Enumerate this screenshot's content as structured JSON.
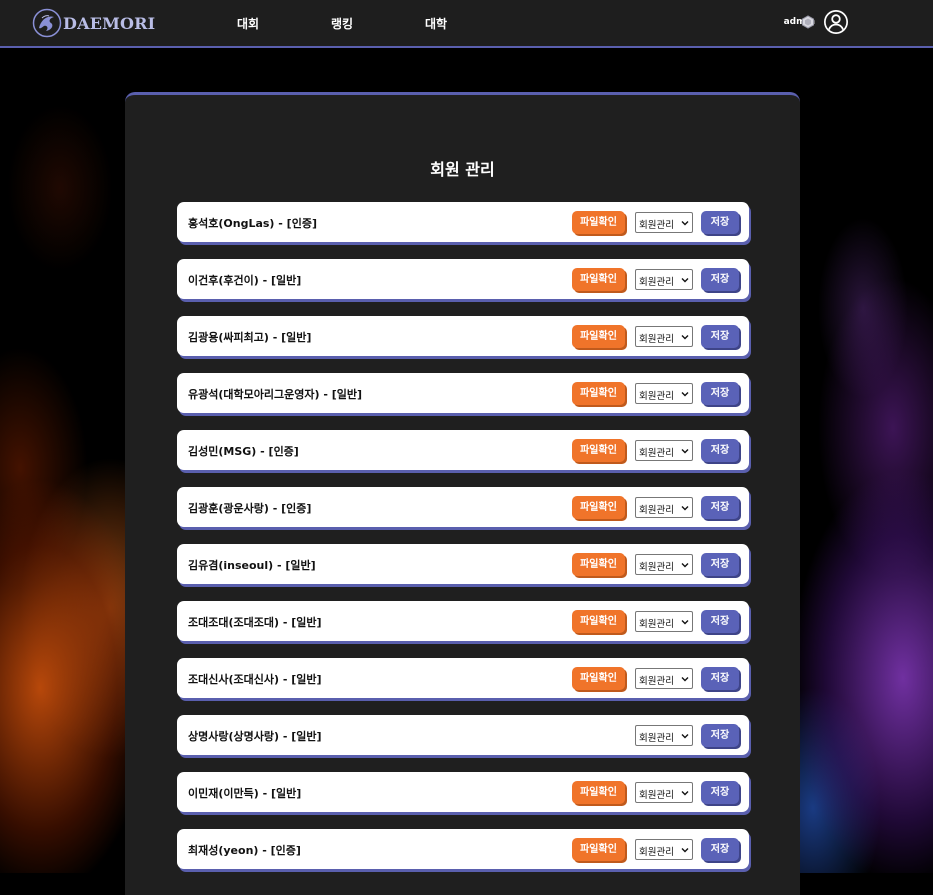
{
  "nav": {
    "logo_text": "DAEMORI",
    "links": [
      "대회",
      "랭킹",
      "대학"
    ],
    "user": "admin"
  },
  "panel": {
    "title": "회원 관리"
  },
  "members": [
    {
      "name": "홍석호(OngLas) - [인증]",
      "has_file": true
    },
    {
      "name": "이건후(후건이) - [일반]",
      "has_file": true
    },
    {
      "name": "김광용(싸피최고) - [일반]",
      "has_file": true
    },
    {
      "name": "유광석(대학모아리그운영자) - [일반]",
      "has_file": true
    },
    {
      "name": "김성민(MSG) - [인증]",
      "has_file": true
    },
    {
      "name": "김광훈(광운사랑) - [인증]",
      "has_file": true
    },
    {
      "name": "김유겸(inseoul) - [일반]",
      "has_file": true
    },
    {
      "name": "조대조대(조대조대) - [일반]",
      "has_file": true
    },
    {
      "name": "조대신사(조대신사) - [일반]",
      "has_file": true
    },
    {
      "name": "상명사랑(상명사랑) - [일반]",
      "has_file": false
    },
    {
      "name": "이민재(이만득) - [일반]",
      "has_file": true
    },
    {
      "name": "최재성(yeon) - [인증]",
      "has_file": true
    }
  ],
  "labels": {
    "file_button": "파일확인",
    "role_select": "회원관리",
    "save_button": "저장"
  },
  "colors": {
    "accent": "#5a62b8",
    "file_button": "#f0742a",
    "nav_bg": "#1e1e1e",
    "panel_bg": "#1f1f1f"
  },
  "icons": {
    "logo": "dragon-logo-icon",
    "badge": "hexagon-badge-icon",
    "avatar": "user-circle-icon",
    "select": "chevron-down-icon"
  }
}
